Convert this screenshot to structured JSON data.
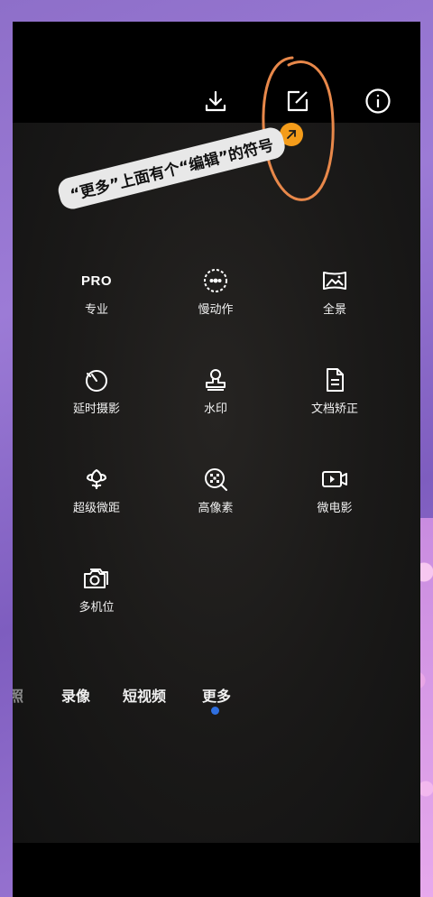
{
  "topbar": {
    "icons": [
      "download-icon",
      "edit-icon",
      "info-icon"
    ]
  },
  "annotation": {
    "text": "“更多”上面有个“编辑”的符号"
  },
  "modes": [
    {
      "icon": "pro-text-icon",
      "icon_text": "PRO",
      "label": "专业"
    },
    {
      "icon": "slow-motion-icon",
      "label": "慢动作"
    },
    {
      "icon": "panorama-icon",
      "label": "全景"
    },
    {
      "icon": "timer-icon",
      "label": "延时摄影"
    },
    {
      "icon": "watermark-stamp-icon",
      "label": "水印"
    },
    {
      "icon": "document-icon",
      "label": "文档矫正"
    },
    {
      "icon": "macro-flower-icon",
      "label": "超级微距"
    },
    {
      "icon": "high-res-icon",
      "label": "高像素"
    },
    {
      "icon": "video-clip-icon",
      "label": "微电影"
    },
    {
      "icon": "multi-camera-icon",
      "label": "多机位"
    }
  ],
  "tabs": [
    {
      "label": "照"
    },
    {
      "label": "录像"
    },
    {
      "label": "短视频"
    },
    {
      "label": "更多",
      "active": true
    }
  ],
  "colors": {
    "accent_dot": "#2f6fe0",
    "badge": "#f49c1a",
    "annotation_circle": "#e8884a"
  }
}
